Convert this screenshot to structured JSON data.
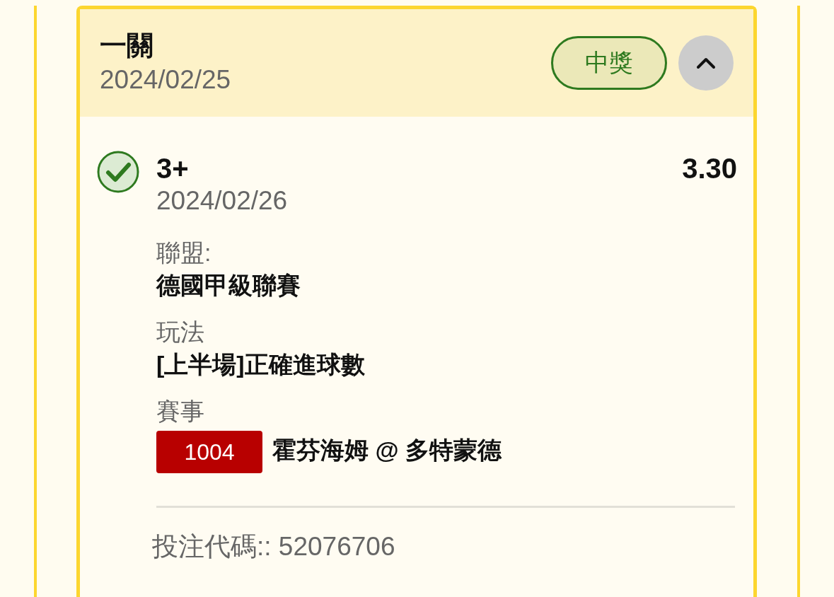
{
  "bet": {
    "title": "一關",
    "date": "2024/02/25",
    "status": "中獎",
    "expanded": true,
    "selection": {
      "won": true,
      "name": "3+",
      "date": "2024/02/26",
      "odds": "3.30"
    },
    "details": [
      {
        "kind": "text",
        "label": "聯盟:",
        "value": "德國甲級聯賽"
      },
      {
        "kind": "text",
        "label": "玩法",
        "value": "[上半場]正確進球數"
      },
      {
        "kind": "match",
        "label": "賽事",
        "tag": "1004",
        "value": "霍芬海姆 @ 多特蒙德"
      }
    ],
    "bet_code": "投注代碼:: 52076706"
  }
}
